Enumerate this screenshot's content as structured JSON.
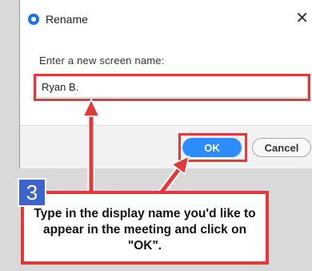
{
  "dialog": {
    "title": "Rename",
    "prompt": "Enter a new screen name:",
    "input_value": "Ryan B.",
    "ok_label": "OK",
    "cancel_label": "Cancel"
  },
  "annotation": {
    "step_number": "3",
    "text": "Type in the display name you'd like to appear in the meeting and click on \"OK\".",
    "color": "#e03a3a"
  },
  "icons": {
    "title": "zoom-app-icon",
    "close": "close-icon"
  },
  "colors": {
    "ok_button": "#2d8cff",
    "step_badge": "#3e63c9"
  }
}
